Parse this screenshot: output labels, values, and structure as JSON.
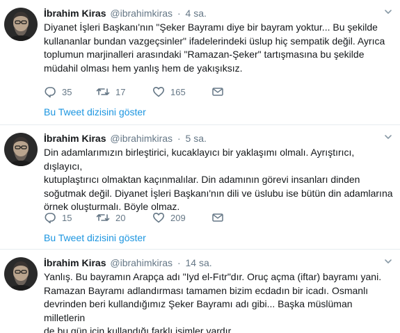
{
  "colors": {
    "link": "#1b95e0",
    "muted": "#657786",
    "text": "#14171a",
    "divider": "#e6ecf0"
  },
  "icons": {
    "reply": "reply-icon",
    "retweet": "retweet-icon",
    "like": "heart-icon",
    "dm": "envelope-icon",
    "more": "chevron-down-icon"
  },
  "tweets": [
    {
      "name": "İbrahim Kiras",
      "handle": "@ibrahimkiras",
      "separator": "·",
      "time": "4 sa.",
      "text": "Diyanet İşleri Başkanı'nın \"Şeker Bayramı diye bir bayram yoktur... Bu şekilde\nkullananlar bundan vazgeçsinler\" ifadelerindeki üslup hiç sempatik değil. Ayrıca\ntoplumun marjinalleri arasındaki \"Ramazan-Şeker\" tartışmasına bu şekilde\nmüdahil olması hem yanlış hem de yakışıksız.",
      "replies": "35",
      "retweets": "17",
      "likes": "165",
      "thread_link": "Bu Tweet dizisini göster"
    },
    {
      "name": "İbrahim Kiras",
      "handle": "@ibrahimkiras",
      "separator": "·",
      "time": "5 sa.",
      "text": "Din adamlarımızın birleştirici, kucaklayıcı bir yaklaşımı olmalı. Ayrıştırıcı, dışlayıcı,\nkutuplaştırıcı olmaktan kaçınmalılar. Din adamının görevi insanları dinden\nsoğutmak değil. Diyanet İşleri Başkanı'nın dili ve üslubu ise bütün din adamlarına\nörnek oluşturmalı. Böyle olmaz.",
      "replies": "15",
      "retweets": "20",
      "likes": "209",
      "thread_link": "Bu Tweet dizisini göster"
    },
    {
      "name": "İbrahim Kiras",
      "handle": "@ibrahimkiras",
      "separator": "·",
      "time": "14 sa.",
      "text": "Yanlış. Bu bayramın Arapça adı \"Iyd el-Fıtr\"dır. Oruç açma (iftar) bayramı yani.\nRamazan Bayramı adlandırması tamamen bizim ecdadın bir icadı. Osmanlı\ndevrinden beri kullandığımız Şeker Bayramı adı gibi... Başka müslüman milletlerin\nde bu gün için kullandığı farklı isimler vardır."
    }
  ]
}
